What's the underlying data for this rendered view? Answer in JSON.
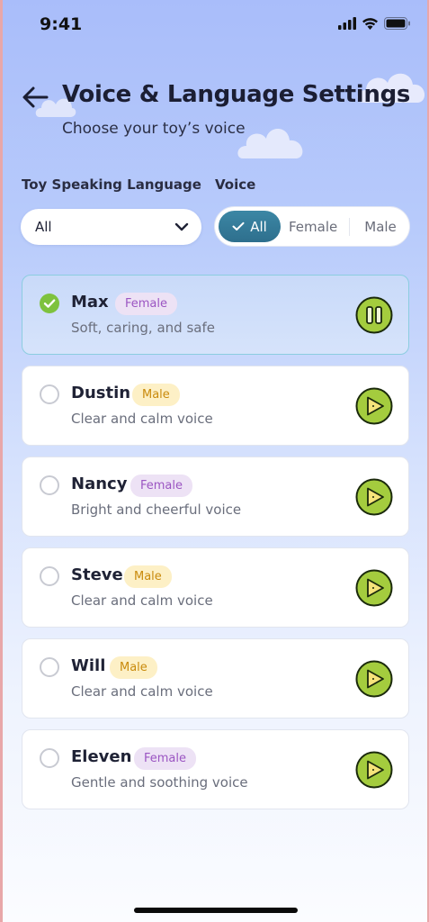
{
  "status_bar": {
    "time": "9:41"
  },
  "header": {
    "title": "Voice & Language Settings",
    "subtitle": "Choose your toy’s voice"
  },
  "filters": {
    "language_label": "Toy Speaking Language",
    "language_value": "All",
    "voice_label": "Voice",
    "voice_options": [
      "All",
      "Female",
      "Male"
    ],
    "voice_selected": "All"
  },
  "voices": [
    {
      "name": "Max",
      "gender": "Female",
      "description": "Soft, caring, and safe",
      "selected": true,
      "playing": true
    },
    {
      "name": "Dustin",
      "gender": "Male",
      "description": "Clear and calm voice",
      "selected": false,
      "playing": false
    },
    {
      "name": "Nancy",
      "gender": "Female",
      "description": "Bright and cheerful voice",
      "selected": false,
      "playing": false
    },
    {
      "name": "Steve",
      "gender": "Male",
      "description": "Clear and calm voice",
      "selected": false,
      "playing": false
    },
    {
      "name": "Will",
      "gender": "Male",
      "description": "Clear and calm voice",
      "selected": false,
      "playing": false
    },
    {
      "name": "Eleven",
      "gender": "Female",
      "description": "Gentle and soothing voice",
      "selected": false,
      "playing": false
    }
  ],
  "colors": {
    "accent_teal": "#3c87a5",
    "check_green": "#7ec23e",
    "play_green": "#a4cc3e",
    "female_badge_text": "#9b55c2",
    "female_badge_bg": "#ede2f5",
    "male_badge_text": "#c98a0c",
    "male_badge_bg": "#fdf0c6"
  }
}
